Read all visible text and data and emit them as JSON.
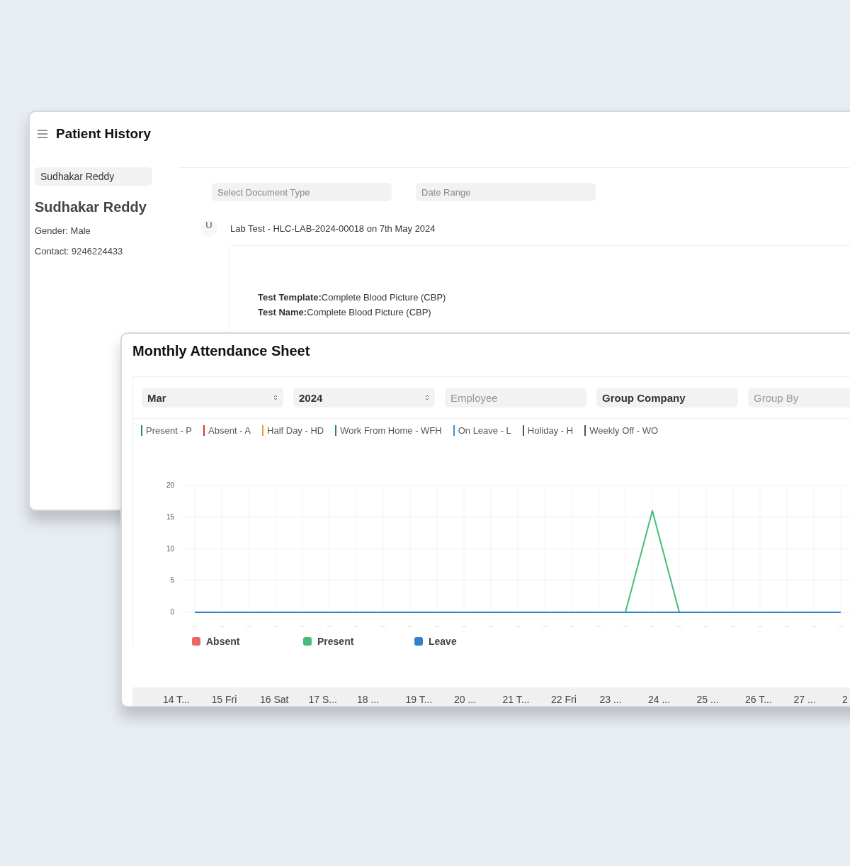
{
  "patient_history": {
    "title": "Patient History",
    "patient_field": {
      "value": "Sudhakar Reddy"
    },
    "patient_name": "Sudhakar Reddy",
    "gender": "Gender: Male",
    "contact": "Contact: 9246224433",
    "filters": [
      {
        "placeholder": "Select Document Type"
      },
      {
        "placeholder": "Date Range"
      }
    ],
    "record": {
      "avatar": "U",
      "title": "Lab Test - HLC-LAB-2024-00018 on 7th May 2024",
      "lines": [
        "**Test Template:**Complete Blood Picture (CBP)",
        "**Test Name:**Complete Blood Picture (CBP)"
      ]
    }
  },
  "attendance": {
    "title": "Monthly Attendance Sheet",
    "filters": [
      {
        "kind": "select",
        "value": "Mar"
      },
      {
        "kind": "select",
        "value": "2024"
      },
      {
        "kind": "input",
        "placeholder": "Employee"
      },
      {
        "kind": "input",
        "value": "Group Company"
      },
      {
        "kind": "input",
        "placeholder": "Group By"
      }
    ],
    "status_legend": [
      {
        "label": "Present - P",
        "color": "#2e8b3e"
      },
      {
        "label": "Absent - A",
        "color": "#e03131"
      },
      {
        "label": "Half Day - HD",
        "color": "#f0a020"
      },
      {
        "label": "Work From Home - WFH",
        "color": "#2e8b3e"
      },
      {
        "label": "On Leave - L",
        "color": "#3a8fd8"
      },
      {
        "label": "Holiday - H",
        "color": "#555555"
      },
      {
        "label": "Weekly Off - WO",
        "color": "#555555"
      }
    ],
    "chart_data": {
      "type": "line",
      "categories": [
        "...",
        "...",
        "...",
        "...",
        "...",
        "...",
        "...",
        "...",
        "...",
        "...",
        "...",
        "...",
        "...",
        "...",
        "...",
        "...",
        "...",
        "...",
        "...",
        "...",
        "...",
        "...",
        "...",
        "...",
        "..."
      ],
      "ylim": [
        0,
        20
      ],
      "grid": true,
      "legend": "bottom",
      "yticks": [
        0,
        5,
        10,
        15,
        20
      ],
      "series": [
        {
          "name": "Absent",
          "color": "#eb6767",
          "values": [
            null,
            null,
            null,
            null,
            null,
            null,
            null,
            null,
            null,
            null,
            null,
            null,
            null,
            null,
            null,
            null,
            null,
            null,
            null,
            null,
            null,
            null,
            null,
            null,
            null
          ]
        },
        {
          "name": "Present",
          "color": "#48bb78",
          "values": [
            null,
            null,
            null,
            null,
            null,
            null,
            null,
            null,
            null,
            null,
            null,
            null,
            null,
            null,
            null,
            null,
            0,
            16,
            0,
            null,
            null,
            null,
            null,
            null,
            null
          ]
        },
        {
          "name": "Leave",
          "color": "#3182ce",
          "values": [
            0,
            0,
            0,
            0,
            0,
            0,
            0,
            0,
            0,
            0,
            0,
            0,
            0,
            0,
            0,
            0,
            0,
            0,
            0,
            0,
            0,
            0,
            0,
            0,
            0
          ]
        }
      ]
    },
    "table_columns": [
      "14 T...",
      "15 Fri",
      "16 Sat",
      "17 S...",
      "18 ...",
      "19 T...",
      "20 ...",
      "21 T...",
      "22 Fri",
      "23 ...",
      "24 ...",
      "25 ...",
      "26 T...",
      "27 ...",
      "2"
    ]
  }
}
